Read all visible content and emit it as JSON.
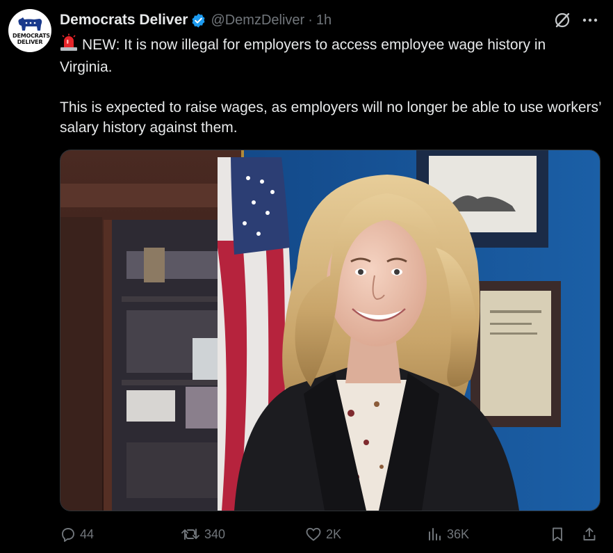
{
  "account": {
    "display_name": "Democrats Deliver",
    "handle": "@DemzDeliver",
    "time": "1h",
    "avatar_text": "DEMOCRATS DELIVER",
    "verified": true
  },
  "tweet": {
    "paragraph_1": "NEW: It is now illegal for employers to access employee wage history in Virginia.",
    "paragraph_2": "This is expected to raise wages, as employers will no longer be able to use workers’ salary history against them.",
    "emoji": "rotating-light-icon"
  },
  "actions": {
    "replies": "44",
    "reposts": "340",
    "likes": "2K",
    "views": "36K"
  },
  "colors": {
    "background": "#000000",
    "text": "#e7e9ea",
    "muted": "#71767b",
    "verified": "#1d9bf0",
    "border": "#2f3336"
  }
}
